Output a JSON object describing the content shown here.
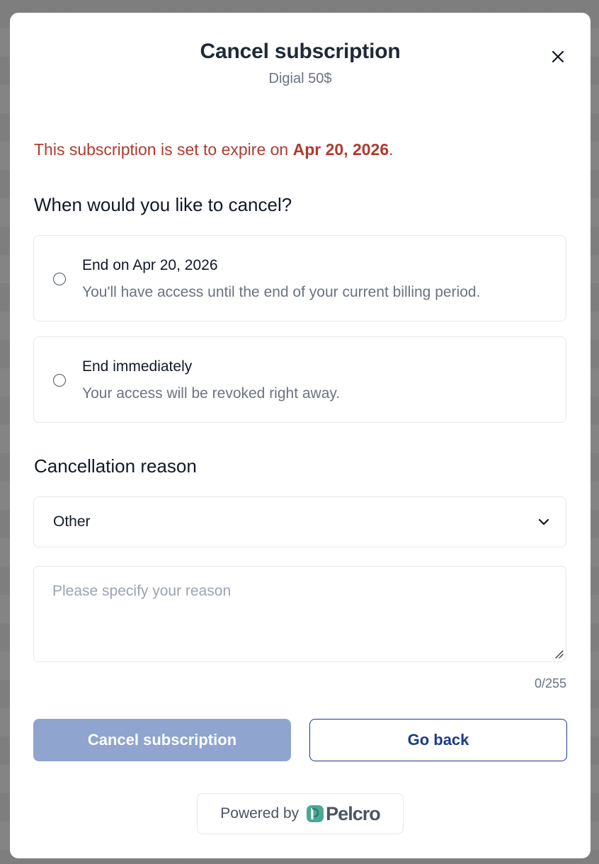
{
  "modal": {
    "title": "Cancel subscription",
    "subtitle": "Digial 50$",
    "close_icon": "close-icon"
  },
  "notice": {
    "prefix": "This subscription is set to expire on ",
    "date": "Apr 20, 2026",
    "suffix": ".",
    "color": "#b03a2e"
  },
  "when": {
    "heading": "When would you like to cancel?",
    "options": [
      {
        "title": "End on Apr 20, 2026",
        "description": "You'll have access until the end of your current billing period.",
        "selected": false
      },
      {
        "title": "End immediately",
        "description": "Your access will be revoked right away.",
        "selected": false
      }
    ]
  },
  "reason": {
    "heading": "Cancellation reason",
    "selected": "Other",
    "placeholder": "Please specify your reason",
    "value": "",
    "char_count": "0/255"
  },
  "actions": {
    "cancel_label": "Cancel subscription",
    "back_label": "Go back",
    "primary_color": "#8fa4cf",
    "secondary_color": "#1e3a8a"
  },
  "footer": {
    "powered_by": "Powered by",
    "brand": "Pelcro",
    "brand_color": "#4aa894"
  }
}
